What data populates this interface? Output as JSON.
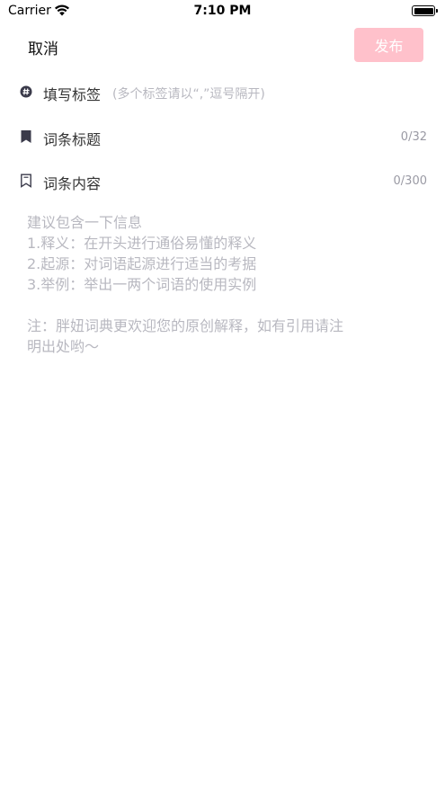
{
  "status_bar": {
    "carrier": "Carrier",
    "time": "7:10 PM"
  },
  "nav": {
    "cancel_label": "取消",
    "publish_label": "发布"
  },
  "form": {
    "tag_row": {
      "label": "填写标签",
      "hint": "(多个标签请以“,”逗号隔开)"
    },
    "title_row": {
      "label": "词条标题",
      "counter": "0/32"
    },
    "content_row": {
      "label": "词条内容",
      "counter": "0/300"
    },
    "content_placeholder": {
      "lines": [
        "建议包含一下信息",
        "1.释义：在开头进行通俗易懂的释义",
        "2.起源：对词语起源进行适当的考据",
        "3.举例：举出一两个词语的使用实例"
      ],
      "note_lines": [
        "注：胖妞词典更欢迎您的原创解释，如有引用请注",
        "明出处哟～"
      ]
    }
  },
  "colors": {
    "publish_bg": "#ffc1cb",
    "placeholder": "#b8b8c0",
    "icon": "#3a3a4a"
  }
}
